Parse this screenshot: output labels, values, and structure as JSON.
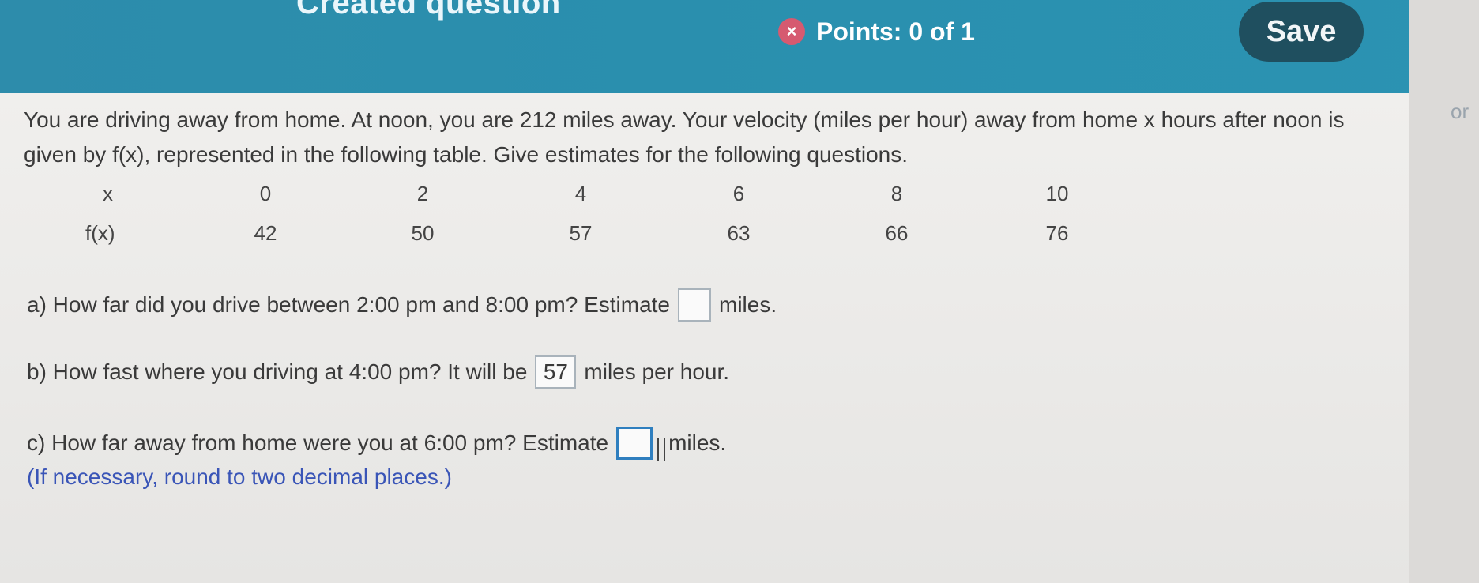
{
  "header": {
    "title": "Created question",
    "points_label": "Points: 0 of 1",
    "save_label": "Save",
    "status_color": "#d65a70"
  },
  "side_fragment": "or",
  "question": {
    "intro": "You are driving away from home. At noon, you are 212 miles away. Your velocity (miles per hour) away from home x hours after noon is given by f(x), represented in the following table. Give estimates for the following questions.",
    "table": {
      "x_label": "x",
      "fx_label": "f(x)",
      "x_values": [
        "0",
        "2",
        "4",
        "6",
        "8",
        "10"
      ],
      "fx_values": [
        "42",
        "50",
        "57",
        "63",
        "66",
        "76"
      ]
    },
    "a": {
      "text": "a) How far did you drive between 2:00 pm and 8:00 pm? Estimate",
      "value": "",
      "unit": "miles."
    },
    "b": {
      "text": "b) How fast where you driving at 4:00 pm? It will be",
      "value": "57",
      "unit": "miles per hour."
    },
    "c": {
      "text": "c) How far away from home were you at 6:00 pm? Estimate",
      "value": "",
      "unit": "miles."
    },
    "note": "(If necessary, round to two decimal places.)"
  }
}
